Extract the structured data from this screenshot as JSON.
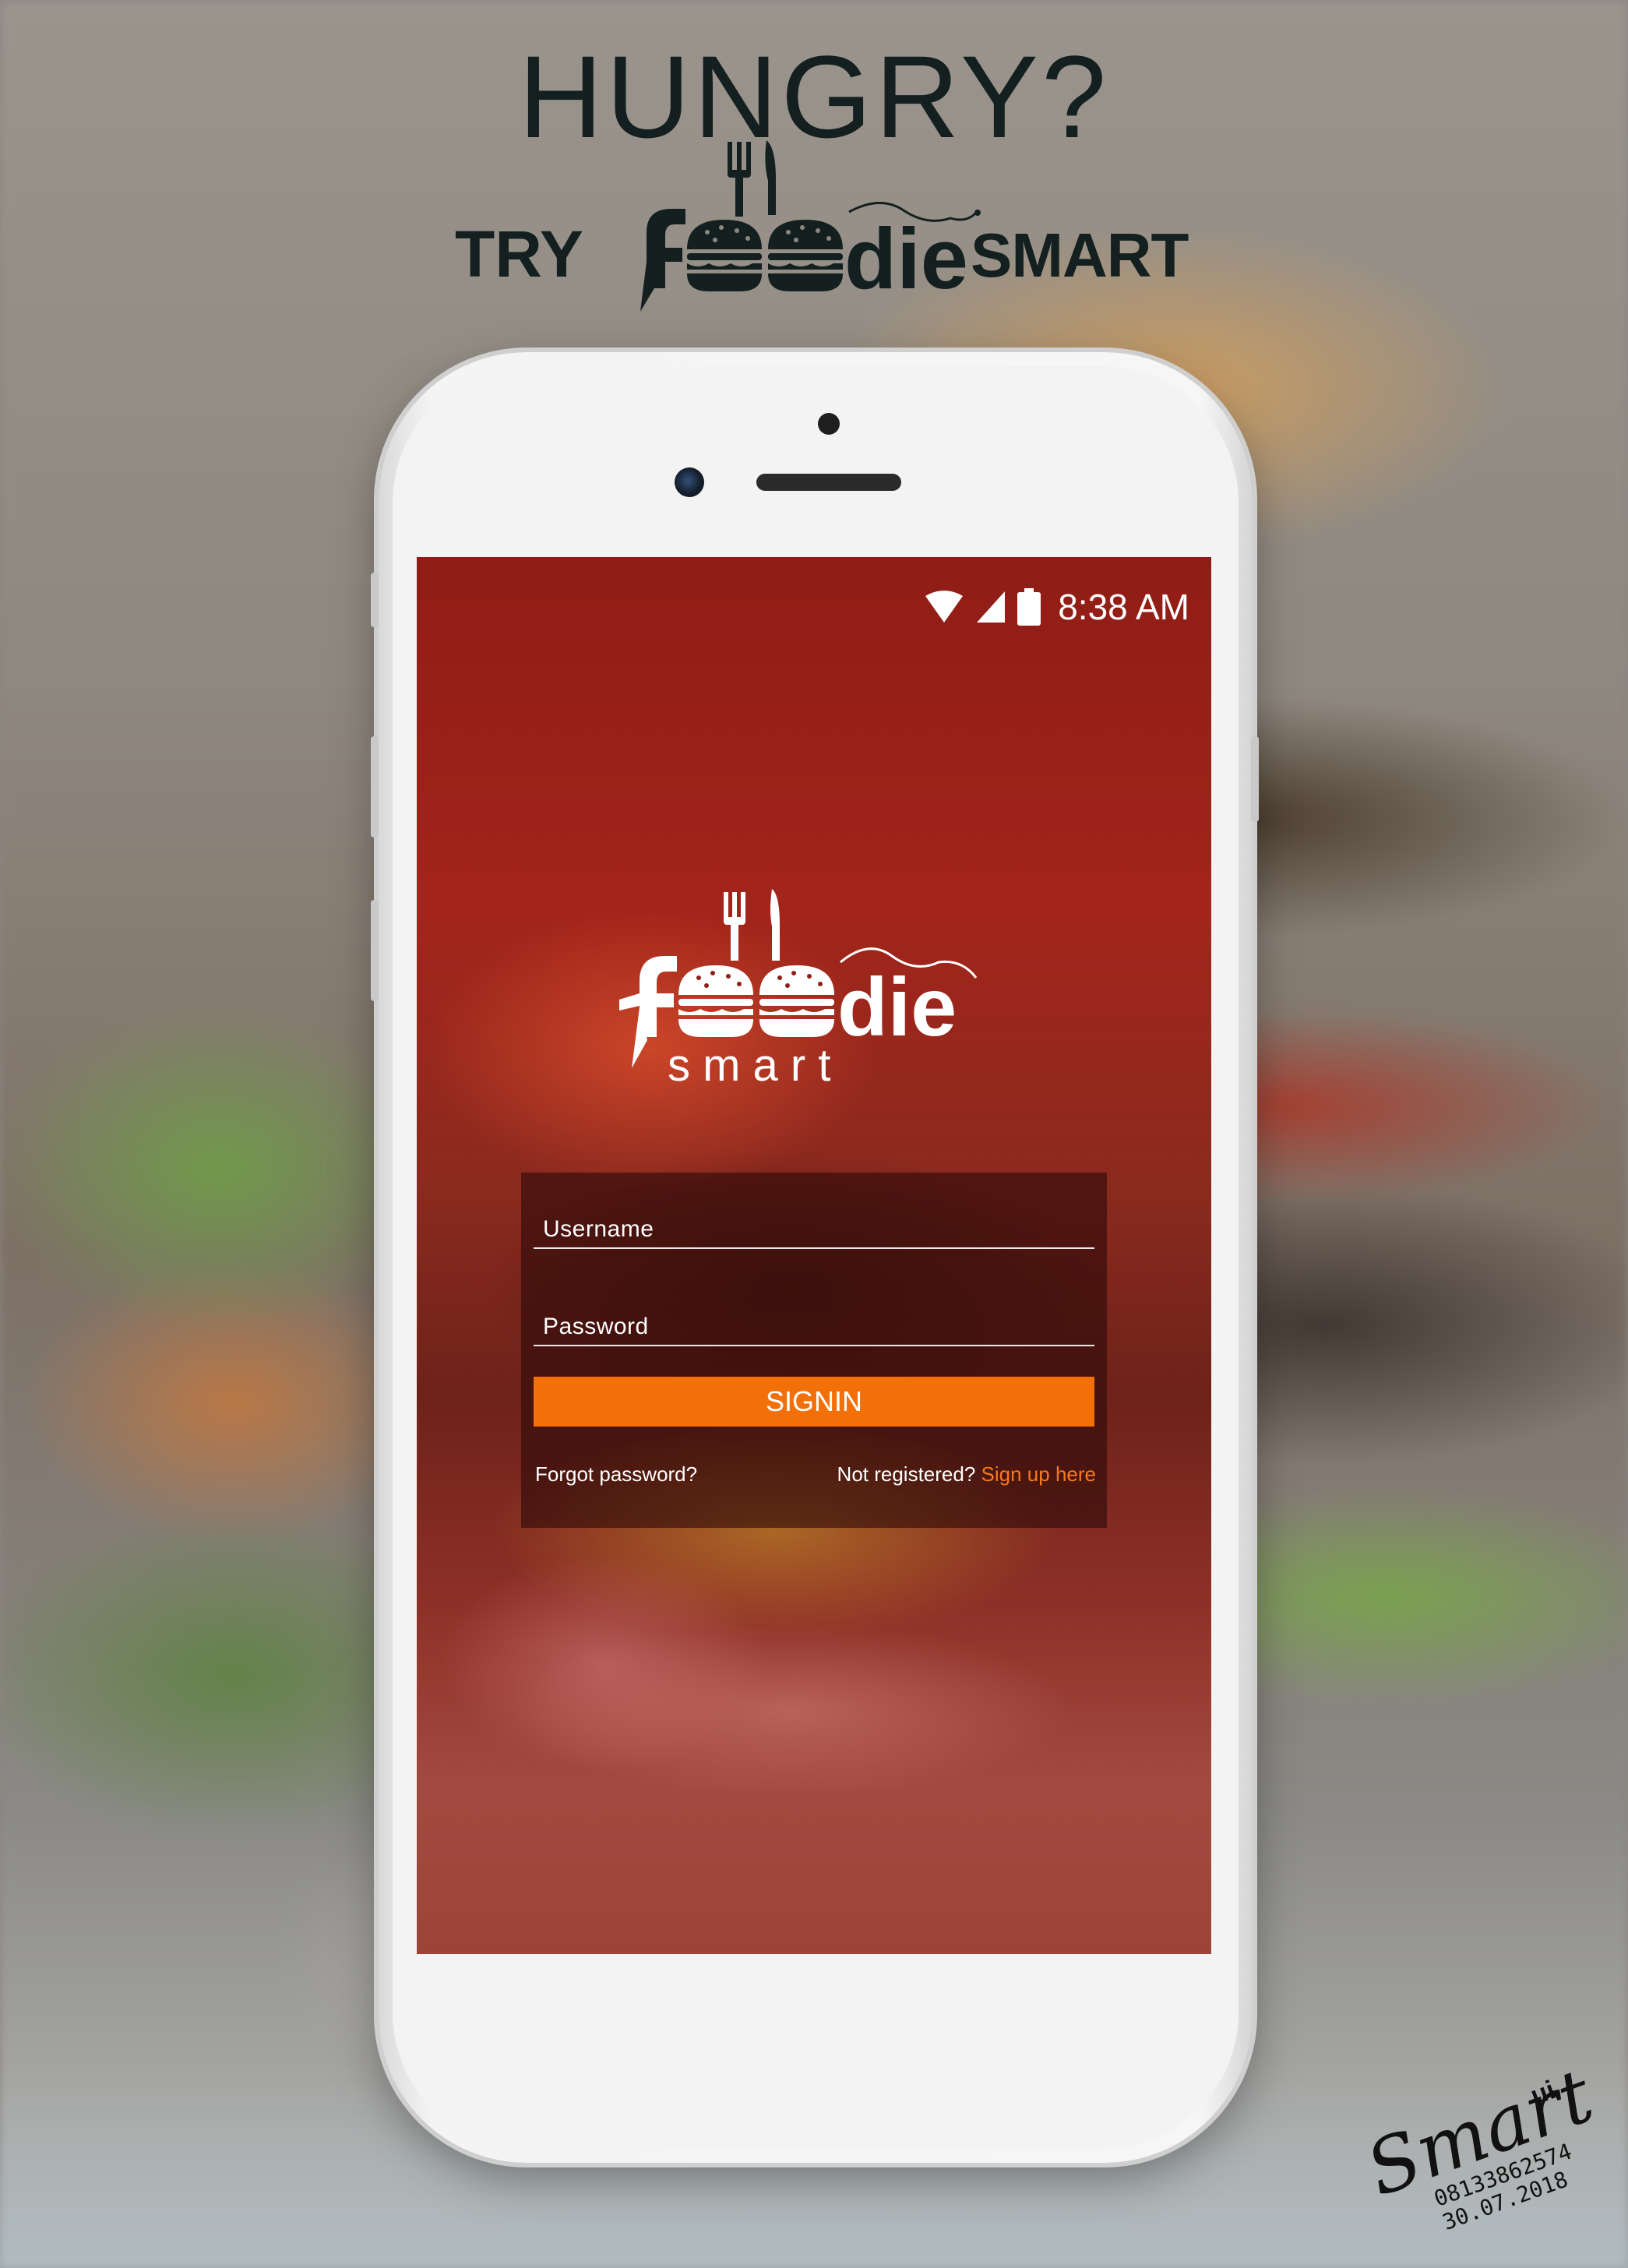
{
  "poster": {
    "headline": "HUNGRY?",
    "try_label": "TRY",
    "brand_logo_text": "foodie",
    "brand_suffix": "SMART"
  },
  "status_bar": {
    "time": "8:38 AM",
    "icons": [
      "wifi-icon",
      "cell-signal-icon",
      "battery-icon"
    ]
  },
  "app": {
    "logo_main": "foodie",
    "logo_sub": "s m a r t",
    "username_placeholder": "Username",
    "password_placeholder": "Password",
    "signin_label": "SIGNIN",
    "forgot_password": "Forgot password?",
    "not_registered": "Not registered?",
    "signup_link": "Sign up here"
  },
  "signature": {
    "name": "Smart",
    "suffix": "ui",
    "phone": "081338625​74",
    "date": "30.07.2018"
  },
  "colors": {
    "accent": "#f37008",
    "link": "#f57a1e",
    "headline": "#13201f"
  }
}
